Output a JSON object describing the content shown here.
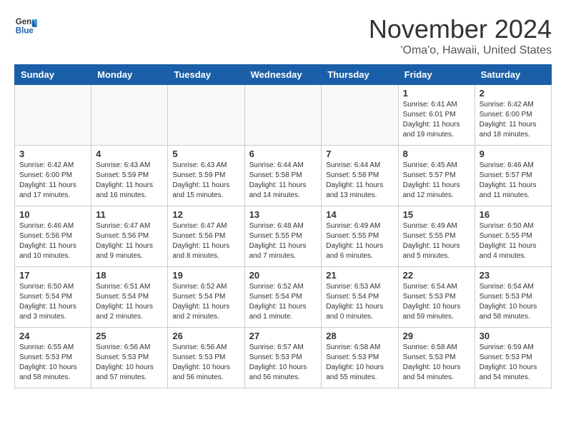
{
  "logo": {
    "line1": "General",
    "line2": "Blue"
  },
  "title": "November 2024",
  "location": "'Oma'o, Hawaii, United States",
  "weekdays": [
    "Sunday",
    "Monday",
    "Tuesday",
    "Wednesday",
    "Thursday",
    "Friday",
    "Saturday"
  ],
  "weeks": [
    [
      {
        "day": "",
        "info": ""
      },
      {
        "day": "",
        "info": ""
      },
      {
        "day": "",
        "info": ""
      },
      {
        "day": "",
        "info": ""
      },
      {
        "day": "",
        "info": ""
      },
      {
        "day": "1",
        "info": "Sunrise: 6:41 AM\nSunset: 6:01 PM\nDaylight: 11 hours and 19 minutes."
      },
      {
        "day": "2",
        "info": "Sunrise: 6:42 AM\nSunset: 6:00 PM\nDaylight: 11 hours and 18 minutes."
      }
    ],
    [
      {
        "day": "3",
        "info": "Sunrise: 6:42 AM\nSunset: 6:00 PM\nDaylight: 11 hours and 17 minutes."
      },
      {
        "day": "4",
        "info": "Sunrise: 6:43 AM\nSunset: 5:59 PM\nDaylight: 11 hours and 16 minutes."
      },
      {
        "day": "5",
        "info": "Sunrise: 6:43 AM\nSunset: 5:59 PM\nDaylight: 11 hours and 15 minutes."
      },
      {
        "day": "6",
        "info": "Sunrise: 6:44 AM\nSunset: 5:58 PM\nDaylight: 11 hours and 14 minutes."
      },
      {
        "day": "7",
        "info": "Sunrise: 6:44 AM\nSunset: 5:58 PM\nDaylight: 11 hours and 13 minutes."
      },
      {
        "day": "8",
        "info": "Sunrise: 6:45 AM\nSunset: 5:57 PM\nDaylight: 11 hours and 12 minutes."
      },
      {
        "day": "9",
        "info": "Sunrise: 6:46 AM\nSunset: 5:57 PM\nDaylight: 11 hours and 11 minutes."
      }
    ],
    [
      {
        "day": "10",
        "info": "Sunrise: 6:46 AM\nSunset: 5:56 PM\nDaylight: 11 hours and 10 minutes."
      },
      {
        "day": "11",
        "info": "Sunrise: 6:47 AM\nSunset: 5:56 PM\nDaylight: 11 hours and 9 minutes."
      },
      {
        "day": "12",
        "info": "Sunrise: 6:47 AM\nSunset: 5:56 PM\nDaylight: 11 hours and 8 minutes."
      },
      {
        "day": "13",
        "info": "Sunrise: 6:48 AM\nSunset: 5:55 PM\nDaylight: 11 hours and 7 minutes."
      },
      {
        "day": "14",
        "info": "Sunrise: 6:49 AM\nSunset: 5:55 PM\nDaylight: 11 hours and 6 minutes."
      },
      {
        "day": "15",
        "info": "Sunrise: 6:49 AM\nSunset: 5:55 PM\nDaylight: 11 hours and 5 minutes."
      },
      {
        "day": "16",
        "info": "Sunrise: 6:50 AM\nSunset: 5:55 PM\nDaylight: 11 hours and 4 minutes."
      }
    ],
    [
      {
        "day": "17",
        "info": "Sunrise: 6:50 AM\nSunset: 5:54 PM\nDaylight: 11 hours and 3 minutes."
      },
      {
        "day": "18",
        "info": "Sunrise: 6:51 AM\nSunset: 5:54 PM\nDaylight: 11 hours and 2 minutes."
      },
      {
        "day": "19",
        "info": "Sunrise: 6:52 AM\nSunset: 5:54 PM\nDaylight: 11 hours and 2 minutes."
      },
      {
        "day": "20",
        "info": "Sunrise: 6:52 AM\nSunset: 5:54 PM\nDaylight: 11 hours and 1 minute."
      },
      {
        "day": "21",
        "info": "Sunrise: 6:53 AM\nSunset: 5:54 PM\nDaylight: 11 hours and 0 minutes."
      },
      {
        "day": "22",
        "info": "Sunrise: 6:54 AM\nSunset: 5:53 PM\nDaylight: 10 hours and 59 minutes."
      },
      {
        "day": "23",
        "info": "Sunrise: 6:54 AM\nSunset: 5:53 PM\nDaylight: 10 hours and 58 minutes."
      }
    ],
    [
      {
        "day": "24",
        "info": "Sunrise: 6:55 AM\nSunset: 5:53 PM\nDaylight: 10 hours and 58 minutes."
      },
      {
        "day": "25",
        "info": "Sunrise: 6:56 AM\nSunset: 5:53 PM\nDaylight: 10 hours and 57 minutes."
      },
      {
        "day": "26",
        "info": "Sunrise: 6:56 AM\nSunset: 5:53 PM\nDaylight: 10 hours and 56 minutes."
      },
      {
        "day": "27",
        "info": "Sunrise: 6:57 AM\nSunset: 5:53 PM\nDaylight: 10 hours and 56 minutes."
      },
      {
        "day": "28",
        "info": "Sunrise: 6:58 AM\nSunset: 5:53 PM\nDaylight: 10 hours and 55 minutes."
      },
      {
        "day": "29",
        "info": "Sunrise: 6:58 AM\nSunset: 5:53 PM\nDaylight: 10 hours and 54 minutes."
      },
      {
        "day": "30",
        "info": "Sunrise: 6:59 AM\nSunset: 5:53 PM\nDaylight: 10 hours and 54 minutes."
      }
    ]
  ]
}
